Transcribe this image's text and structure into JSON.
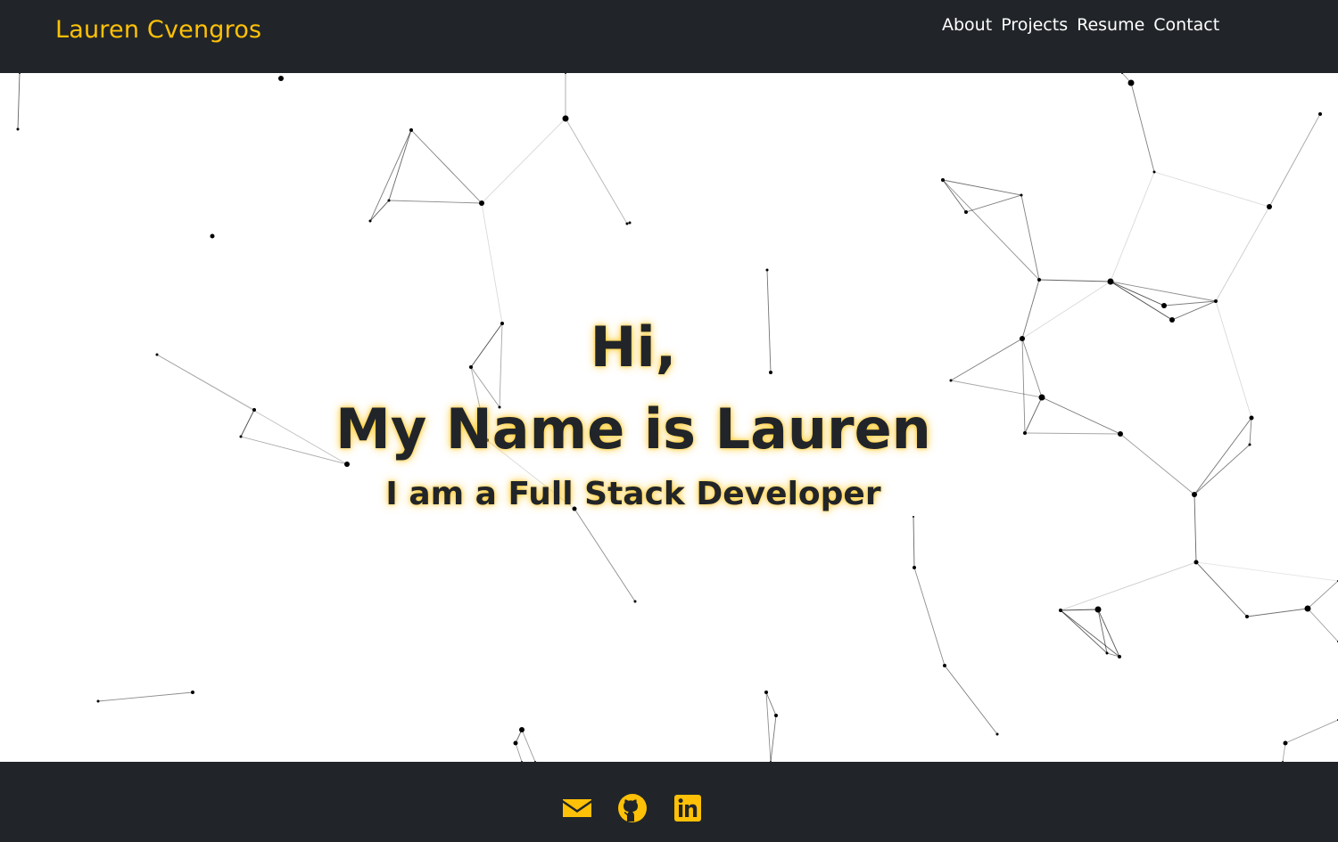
{
  "navbar": {
    "brand": "Lauren Cvengros",
    "links": [
      {
        "label": "About"
      },
      {
        "label": "Projects"
      },
      {
        "label": "Resume"
      },
      {
        "label": "Contact"
      }
    ]
  },
  "hero": {
    "line1": "Hi,",
    "line2": "My Name is Lauren",
    "subtitle": "I am a Full Stack Developer"
  },
  "footer": {
    "icons": [
      "envelope-icon",
      "github-icon",
      "linkedin-icon"
    ]
  },
  "colors": {
    "accent": "#ffc107",
    "dark": "#212529",
    "background": "#ffffff"
  }
}
